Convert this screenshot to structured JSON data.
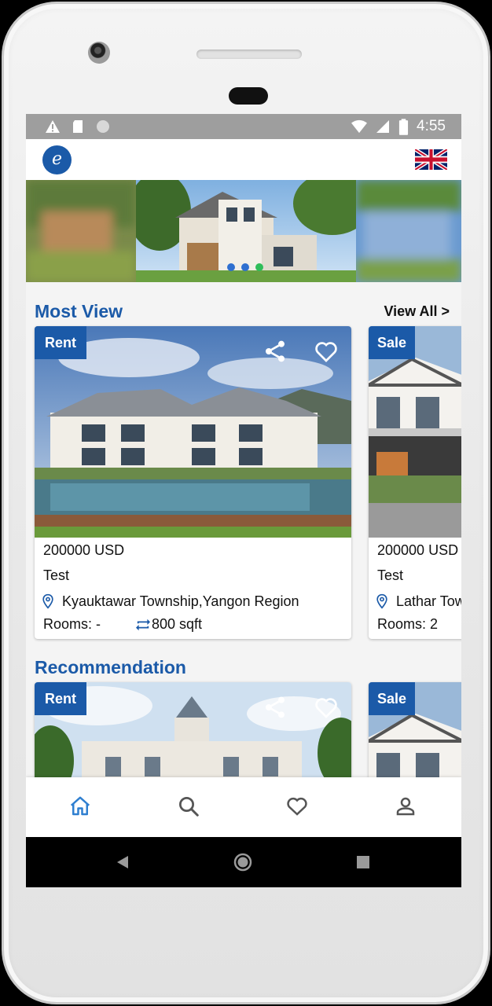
{
  "status_bar": {
    "time": "4:55",
    "left_icons": [
      "warning-icon",
      "sd-card-icon",
      "circle-icon"
    ],
    "right_icons": [
      "wifi-icon",
      "signal-icon",
      "battery-icon"
    ]
  },
  "app_bar": {
    "logo_letter": "e",
    "language_flag": "uk-flag-icon"
  },
  "carousel": {
    "slide_count": 3,
    "active_slide": 3
  },
  "sections": {
    "most_view": {
      "title": "Most View",
      "view_all_label": "View All >",
      "cards": [
        {
          "badge": "Rent",
          "price": "200000 USD",
          "name": "Test",
          "location": "Kyauktawar Township,Yangon Region",
          "rooms": "Rooms: -",
          "area": "800 sqft"
        },
        {
          "badge": "Sale",
          "price": "200000 USD",
          "name": "Test",
          "location": "Lathar Tow",
          "rooms": "Rooms: 2",
          "area": ""
        }
      ]
    },
    "recommendation": {
      "title": "Recommendation",
      "cards": [
        {
          "badge": "Rent"
        },
        {
          "badge": "Sale"
        }
      ]
    }
  },
  "bottom_nav": {
    "items": [
      "home-icon",
      "search-icon",
      "favorite-icon",
      "profile-icon"
    ],
    "active": "home-icon"
  },
  "colors": {
    "brand_blue": "#1b5aa8",
    "nav_active": "#2f7fd0",
    "nav_inactive": "#555555"
  }
}
